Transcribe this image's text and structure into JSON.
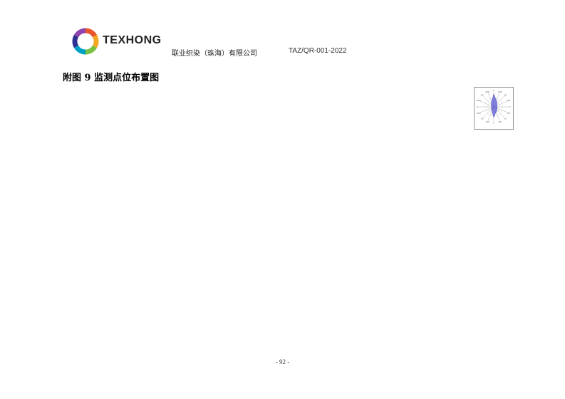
{
  "header": {
    "brand": "TEXHONG",
    "company": "联业织染（珠海）有限公司",
    "doc_number": "TAZ/QR-001-2022",
    "logo_icon": "texhong-ring-logo",
    "logo_colors": [
      "#e8542c",
      "#f5a623",
      "#7ac143",
      "#00a0c6",
      "#2e3192",
      "#8e44ad"
    ]
  },
  "content": {
    "title": "附图 9 监测点位布置图"
  },
  "wind_rose": {
    "icon": "wind-rose-icon",
    "fill_color": "#5b5bd6",
    "caption": "",
    "directions": [
      "N",
      "NNE",
      "NE",
      "ENE",
      "E",
      "ESE",
      "SE",
      "SSE",
      "S",
      "SSW",
      "SW",
      "WSW",
      "W",
      "WNW",
      "NW",
      "NNW"
    ],
    "frequencies": [
      11,
      6,
      4,
      3,
      3,
      3,
      4,
      5,
      9,
      4,
      3,
      2,
      2,
      2,
      3,
      5
    ]
  },
  "footer": {
    "page_number": "- 92 -"
  }
}
